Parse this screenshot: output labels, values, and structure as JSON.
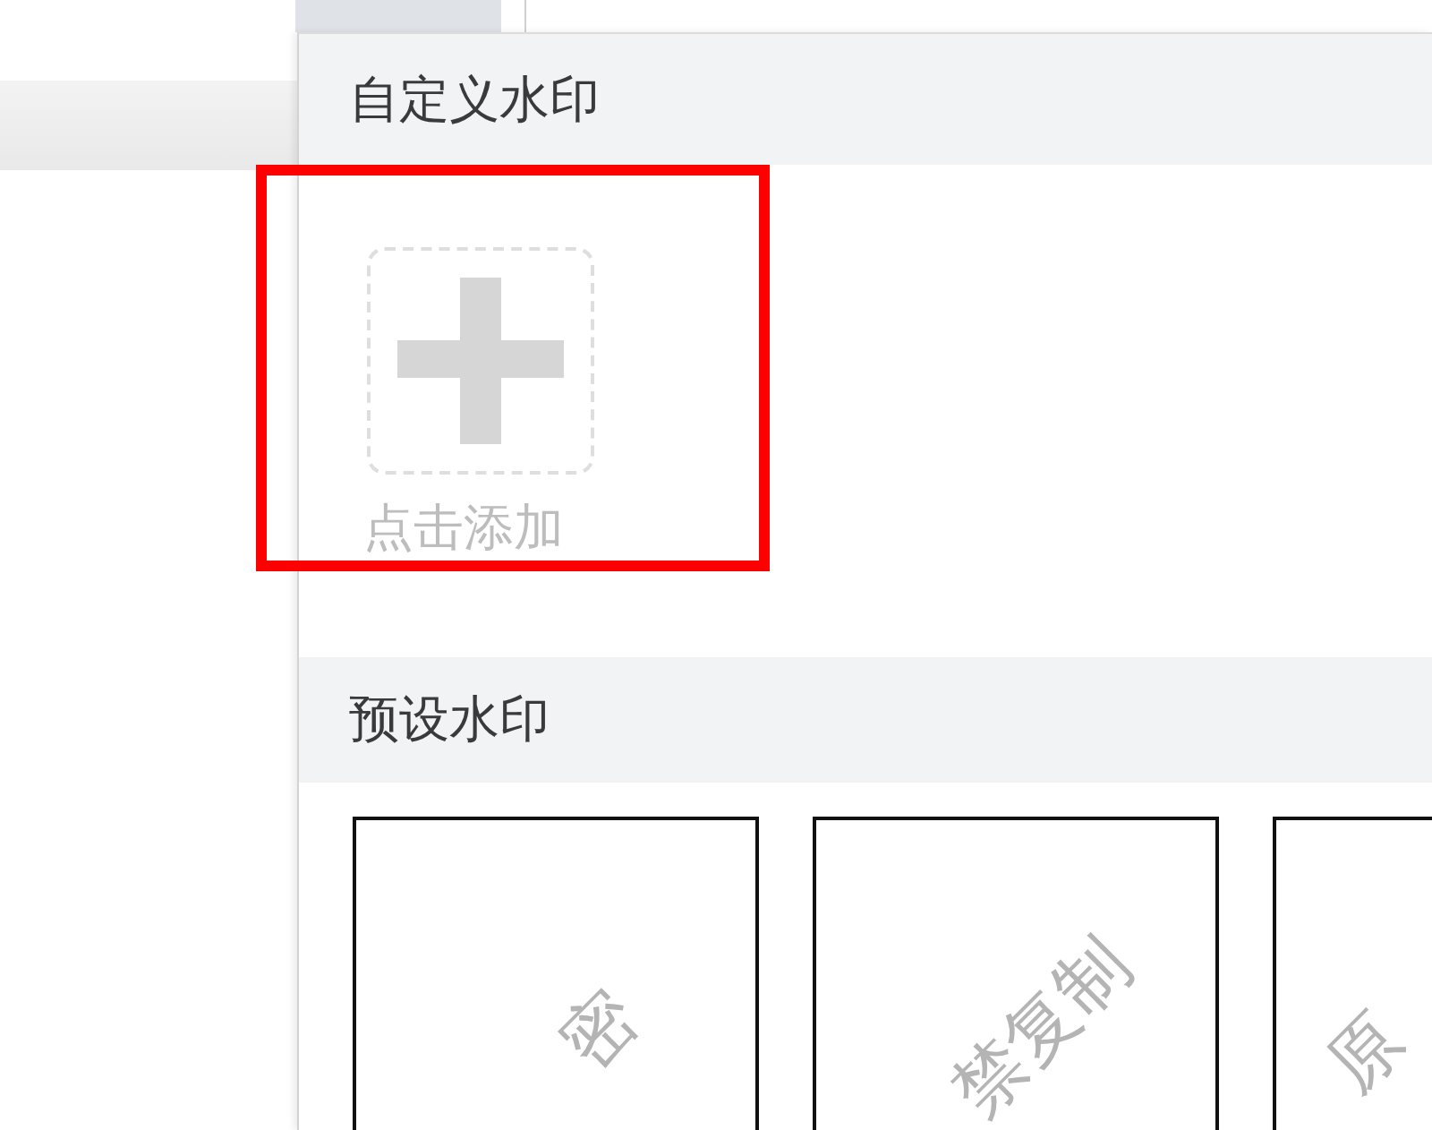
{
  "toolbar": {
    "tab_selected": true
  },
  "custom_watermark": {
    "title": "自定义水印",
    "add_label": "点击添加",
    "highlighted": true
  },
  "preset_watermarks": {
    "title": "预设水印",
    "items": [
      {
        "text": "密"
      },
      {
        "text": "禁复制"
      },
      {
        "text": "原"
      }
    ]
  }
}
